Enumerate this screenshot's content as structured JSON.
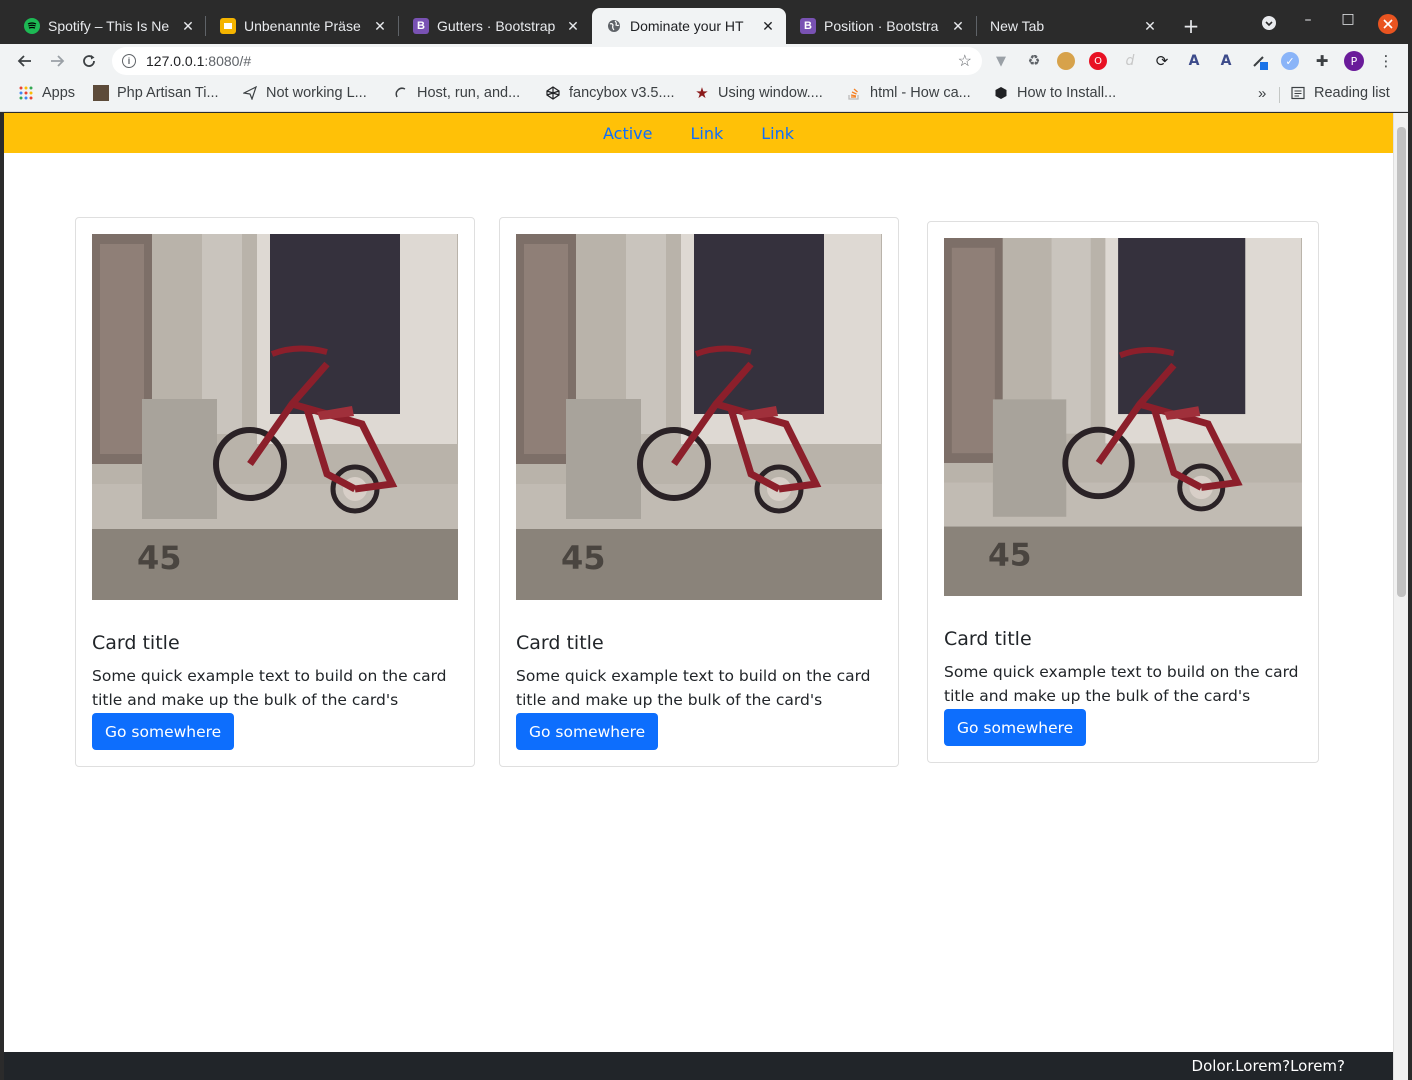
{
  "browser": {
    "tabs": [
      {
        "title": "Spotify – This Is Ne",
        "favicon": "spotify-icon",
        "color": "#1db954"
      },
      {
        "title": "Unbenannte Präse",
        "favicon": "slides-icon",
        "color": "#f4b400"
      },
      {
        "title": "Gutters · Bootstrap",
        "favicon": "bootstrap-icon",
        "color": "#7952b3"
      },
      {
        "title": "Dominate your HT",
        "favicon": "globe-icon",
        "color": "#5f6368"
      },
      {
        "title": "Position · Bootstra",
        "favicon": "bootstrap-icon",
        "color": "#7952b3"
      },
      {
        "title": "New Tab",
        "favicon": "",
        "color": ""
      }
    ],
    "url_host": "127.0.0.1",
    "url_path": ":8080/#",
    "profile_initial": "P",
    "bookmarks": [
      {
        "label": "Apps",
        "icon": "apps-grid-icon"
      },
      {
        "label": "Php Artisan Ti...",
        "icon": "artisan-icon"
      },
      {
        "label": "Not working L...",
        "icon": "paper-plane-icon"
      },
      {
        "label": "Host, run, and...",
        "icon": "glitch-icon"
      },
      {
        "label": "fancybox v3.5....",
        "icon": "codepen-icon"
      },
      {
        "label": "Using window....",
        "icon": "star-icon"
      },
      {
        "label": "html - How ca...",
        "icon": "stackoverflow-icon"
      },
      {
        "label": "How to Install...",
        "icon": "hexagon-icon"
      }
    ],
    "bookmarks_overflow": "»",
    "reading_list": "Reading list"
  },
  "page": {
    "nav": [
      {
        "label": "Active"
      },
      {
        "label": "Link"
      },
      {
        "label": "Link"
      }
    ],
    "cards": [
      {
        "title": "Card title",
        "text": "Some quick example text to build on the card title and make up the bulk of the card's content.",
        "button": "Go somewhere"
      },
      {
        "title": "Card title",
        "text": "Some quick example text to build on the card title and make up the bulk of the card's content.",
        "button": "Go somewhere"
      },
      {
        "title": "Card title",
        "text": "Some quick example text to build on the card title and make up the bulk of the card's content.",
        "button": "Go somewhere"
      }
    ],
    "footer_text": "Dolor.Lorem?Lorem?"
  },
  "colors": {
    "navbar_bg": "#ffc107",
    "link": "#0d6efd",
    "button": "#0d6efd",
    "footer_bg": "#212529"
  }
}
